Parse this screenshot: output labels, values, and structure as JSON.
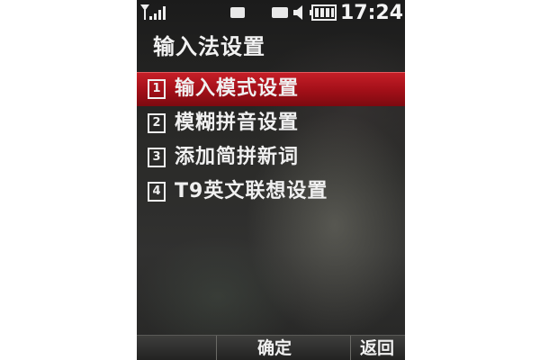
{
  "status_bar": {
    "time": "17:24",
    "icons": [
      "signal-icon",
      "message-icon",
      "mail-icon",
      "speaker-icon",
      "battery-icon"
    ]
  },
  "title": "输入法设置",
  "menu": {
    "items": [
      {
        "number": "1",
        "label": "输入模式设置",
        "selected": true
      },
      {
        "number": "2",
        "label": "模糊拼音设置",
        "selected": false
      },
      {
        "number": "3",
        "label": "添加简拼新词",
        "selected": false
      },
      {
        "number": "4",
        "label": "T9英文联想设置",
        "selected": false
      }
    ]
  },
  "softkeys": {
    "center": "确定",
    "right": "返回"
  },
  "colors": {
    "selection": "#b0141c",
    "text": "#f0f0f0"
  }
}
